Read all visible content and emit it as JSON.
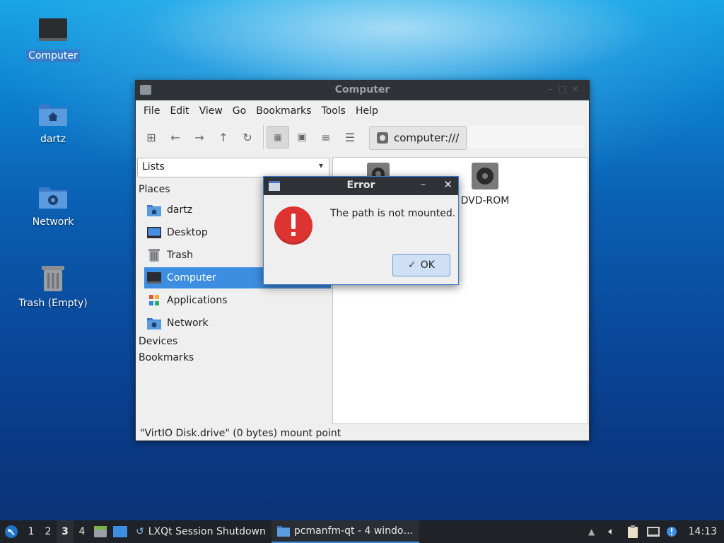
{
  "desktop": {
    "icons": [
      {
        "label": "Computer",
        "icon": "computer-icon"
      },
      {
        "label": "dartz",
        "icon": "home-folder-icon"
      },
      {
        "label": "Network",
        "icon": "network-folder-icon"
      },
      {
        "label": "Trash (Empty)",
        "icon": "trash-icon"
      }
    ]
  },
  "window": {
    "title": "Computer",
    "menu": [
      "File",
      "Edit",
      "View",
      "Go",
      "Bookmarks",
      "Tools",
      "Help"
    ],
    "path": "computer:///",
    "side_combo_value": "Lists",
    "sections": {
      "places": "Places",
      "devices": "Devices",
      "bookmarks": "Bookmarks"
    },
    "places": [
      {
        "label": "dartz",
        "icon": "home-folder-icon"
      },
      {
        "label": "Desktop",
        "icon": "desktop-icon"
      },
      {
        "label": "Trash",
        "icon": "trash-icon"
      },
      {
        "label": "Computer",
        "icon": "computer-icon",
        "selected": true
      },
      {
        "label": "Applications",
        "icon": "applications-icon"
      },
      {
        "label": "Network",
        "icon": "network-folder-icon"
      }
    ],
    "files": [
      {
        "label": "",
        "icon": "disk-icon"
      },
      {
        "label": "DVD-ROM",
        "icon": "dvd-icon"
      }
    ],
    "status": "\"VirtIO Disk.drive\" (0 bytes) mount point"
  },
  "dialog": {
    "title": "Error",
    "message": "The path is not mounted.",
    "ok_label": "OK"
  },
  "taskbar": {
    "workspaces": [
      "1",
      "2",
      "3",
      "4"
    ],
    "current_workspace": "3",
    "tasks": [
      "LXQt Session Shutdown",
      "pcmanfm-qt - 4 windo…"
    ],
    "clock": "14:13"
  },
  "colors": {
    "accent": "#3d8ee0",
    "titlebar": "#2f3237",
    "error": "#dd3331"
  }
}
